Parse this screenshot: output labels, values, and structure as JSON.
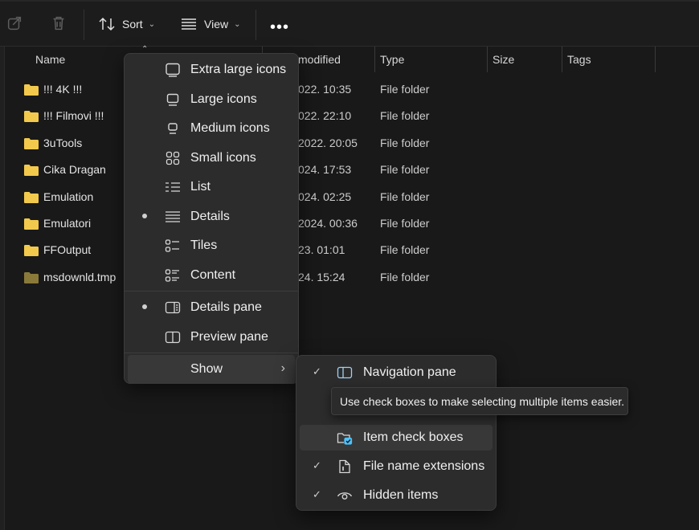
{
  "toolbar": {
    "sort_label": "Sort",
    "view_label": "View",
    "more_label": "•••",
    "icons": [
      "share-icon",
      "delete-icon",
      "sort-icon",
      "view-icon"
    ]
  },
  "columns": {
    "name": "Name",
    "date_modified": "modified",
    "type": "Type",
    "size": "Size",
    "tags": "Tags"
  },
  "files": [
    {
      "name": "!!! 4K !!!",
      "date": "022. 10:35",
      "type": "File folder"
    },
    {
      "name": "!!! Filmovi !!!",
      "date": "022. 22:10",
      "type": "File folder"
    },
    {
      "name": "3uTools",
      "date": "2022. 20:05",
      "type": "File folder"
    },
    {
      "name": "Cika Dragan",
      "date": "024. 17:53",
      "type": "File folder"
    },
    {
      "name": "Emulation",
      "date": "024. 02:25",
      "type": "File folder"
    },
    {
      "name": "Emulatori",
      "date": "2024. 00:36",
      "type": "File folder"
    },
    {
      "name": "FFOutput",
      "date": "23. 01:01",
      "type": "File folder"
    },
    {
      "name": "msdownld.tmp",
      "date": "24. 15:24",
      "type": "File folder"
    }
  ],
  "view_menu": {
    "items": [
      {
        "label": "Extra large icons",
        "icon": "extra-large-icons-icon",
        "selected": false
      },
      {
        "label": "Large icons",
        "icon": "large-icons-icon",
        "selected": false
      },
      {
        "label": "Medium icons",
        "icon": "medium-icons-icon",
        "selected": false
      },
      {
        "label": "Small icons",
        "icon": "small-icons-icon",
        "selected": false
      },
      {
        "label": "List",
        "icon": "list-icon",
        "selected": false
      },
      {
        "label": "Details",
        "icon": "details-icon",
        "selected": true
      },
      {
        "label": "Tiles",
        "icon": "tiles-icon",
        "selected": false
      },
      {
        "label": "Content",
        "icon": "content-icon",
        "selected": false
      }
    ],
    "panes": [
      {
        "label": "Details pane",
        "icon": "details-pane-icon",
        "selected": true
      },
      {
        "label": "Preview pane",
        "icon": "preview-pane-icon",
        "selected": false
      }
    ],
    "show_label": "Show",
    "show_arrow": "›"
  },
  "show_menu": {
    "items": [
      {
        "label": "Navigation pane",
        "icon": "navigation-pane-icon",
        "checked": true
      },
      {
        "label": "Item check boxes",
        "icon": "item-check-boxes-icon",
        "checked": false
      },
      {
        "label": "File name extensions",
        "icon": "file-name-extensions-icon",
        "checked": true
      },
      {
        "label": "Hidden items",
        "icon": "hidden-items-icon",
        "checked": true
      }
    ],
    "check_glyph": "✓"
  },
  "tooltip": "Use check boxes to make selecting multiple items easier.",
  "colors": {
    "folder": "#f2c94c",
    "folder_dim": "#8a7a3a",
    "accent": "#4cc2ff",
    "menu_bg": "#2c2c2c",
    "window_bg": "#191919"
  }
}
